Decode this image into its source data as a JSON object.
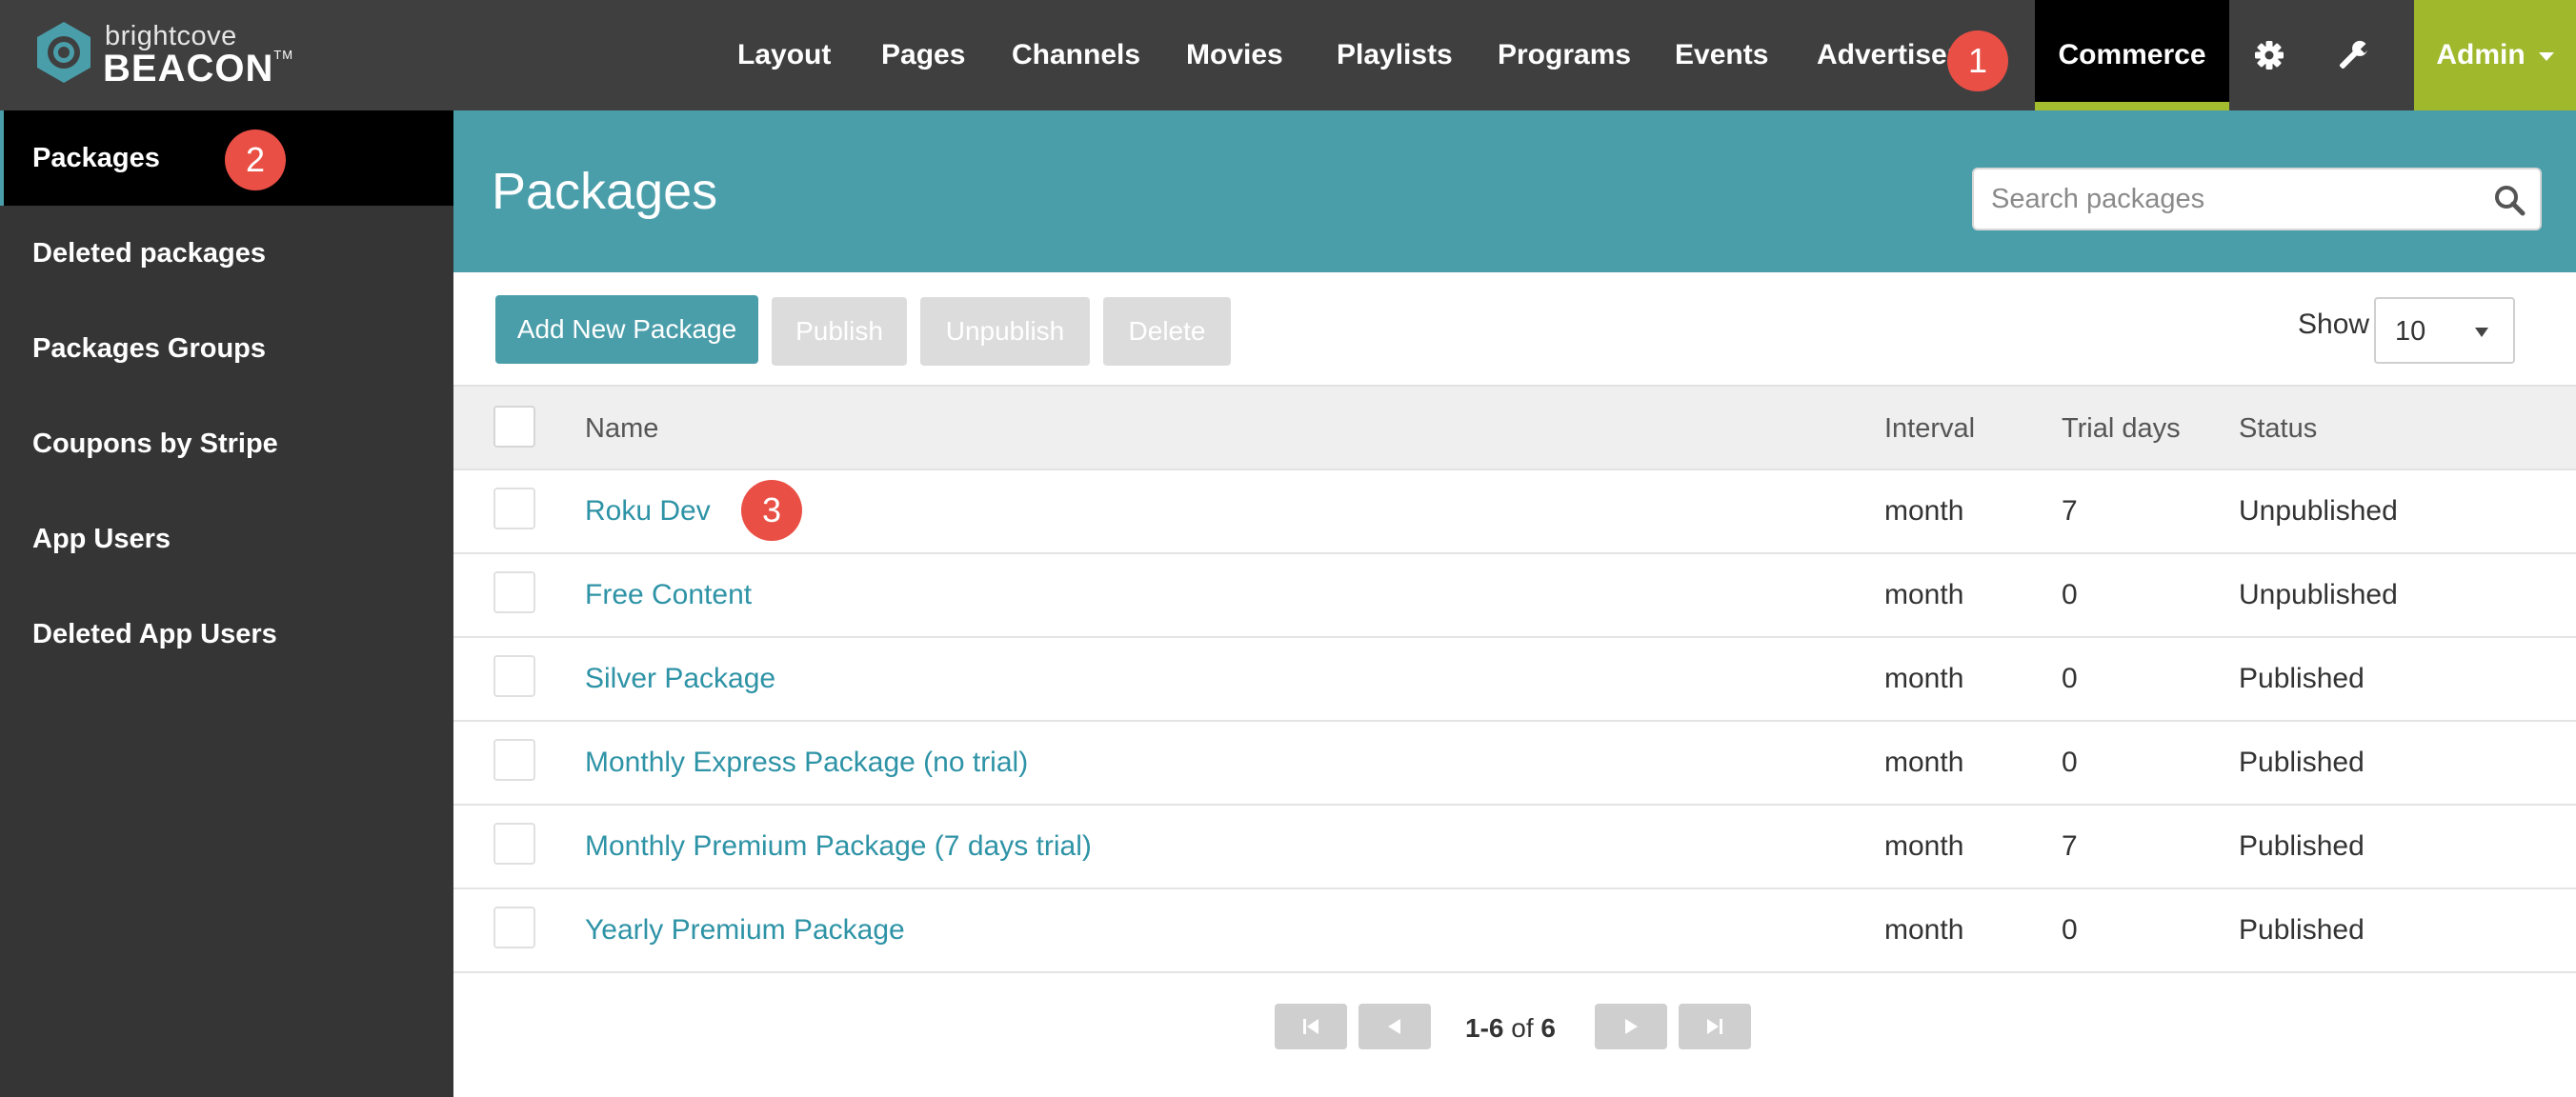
{
  "brand": {
    "small": "brightcove",
    "big": "BEACON",
    "tm": "TM",
    "accent": "#4a9eaa",
    "admin_color": "#9fb82c"
  },
  "nav": {
    "items": [
      "Layout",
      "Pages",
      "Channels",
      "Movies",
      "Playlists",
      "Programs",
      "Events",
      "Advertiser"
    ],
    "active": "Commerce",
    "icons": [
      "gear-icon",
      "wrench-icon"
    ],
    "admin": "Admin"
  },
  "badges": [
    "1",
    "2",
    "3"
  ],
  "sidebar": {
    "items": [
      {
        "label": "Packages",
        "active": true
      },
      {
        "label": "Deleted packages"
      },
      {
        "label": "Packages Groups"
      },
      {
        "label": "Coupons by Stripe"
      },
      {
        "label": "App Users"
      },
      {
        "label": "Deleted App Users"
      }
    ]
  },
  "header": {
    "title": "Packages",
    "search_placeholder": "Search packages"
  },
  "toolbar": {
    "add": "Add New Package",
    "publish": "Publish",
    "unpublish": "Unpublish",
    "delete": "Delete",
    "show_label": "Show",
    "show_value": "10"
  },
  "table": {
    "columns": [
      "Name",
      "Interval",
      "Trial days",
      "Status"
    ],
    "rows": [
      {
        "name": "Roku Dev",
        "interval": "month",
        "trial": "7",
        "status": "Unpublished"
      },
      {
        "name": "Free Content",
        "interval": "month",
        "trial": "0",
        "status": "Unpublished"
      },
      {
        "name": "Silver Package",
        "interval": "month",
        "trial": "0",
        "status": "Published"
      },
      {
        "name": "Monthly Express Package (no trial)",
        "interval": "month",
        "trial": "0",
        "status": "Published"
      },
      {
        "name": "Monthly Premium Package (7 days trial)",
        "interval": "month",
        "trial": "7",
        "status": "Published"
      },
      {
        "name": "Yearly Premium Package",
        "interval": "month",
        "trial": "0",
        "status": "Published"
      }
    ]
  },
  "pager": {
    "range": "1-6",
    "of": "of",
    "total": "6"
  }
}
